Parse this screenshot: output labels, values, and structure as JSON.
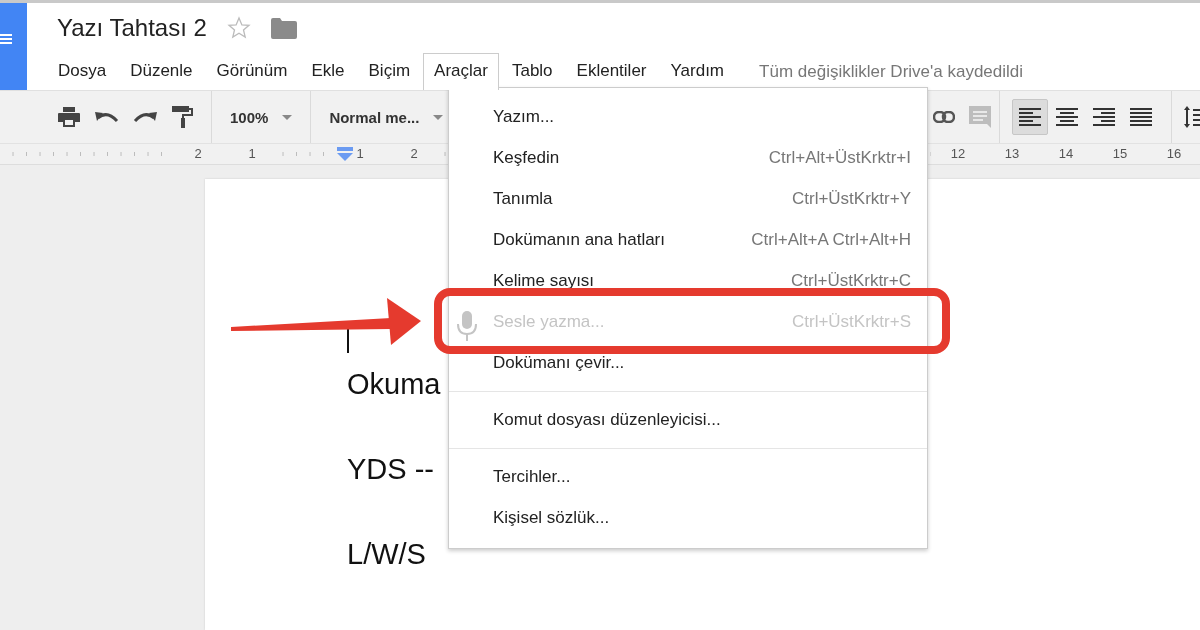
{
  "document": {
    "title": "Yazı Tahtası 2",
    "starred": false
  },
  "menus": [
    {
      "label": "Dosya",
      "selected": false
    },
    {
      "label": "Düzenle",
      "selected": false
    },
    {
      "label": "Görünüm",
      "selected": false
    },
    {
      "label": "Ekle",
      "selected": false
    },
    {
      "label": "Biçim",
      "selected": false
    },
    {
      "label": "Araçlar",
      "selected": true
    },
    {
      "label": "Tablo",
      "selected": false
    },
    {
      "label": "Eklentiler",
      "selected": false
    },
    {
      "label": "Yardım",
      "selected": false
    }
  ],
  "save_status": "Tüm değişiklikler Drive'a kaydedildi",
  "toolbar": {
    "zoom": "100%",
    "style": "Normal me...",
    "alignment": [
      {
        "selected": true
      },
      {
        "selected": false
      },
      {
        "selected": false
      },
      {
        "selected": false
      }
    ]
  },
  "ruler": {
    "left_labels": [
      "2",
      "1"
    ],
    "right_labels": [
      "1",
      "2"
    ],
    "far_labels": [
      "12",
      "13",
      "14",
      "15",
      "16"
    ]
  },
  "body_lines": [
    "Okuma",
    "YDS --",
    "L/W/S"
  ],
  "tools_menu": [
    {
      "kind": "item",
      "label": "Yazım...",
      "disabled": false
    },
    {
      "kind": "item",
      "label": "Keşfedin",
      "shortcut": "Ctrl+Alt+ÜstKrktr+I",
      "disabled": false
    },
    {
      "kind": "item",
      "label": "Tanımla",
      "shortcut": "Ctrl+ÜstKrktr+Y",
      "disabled": false
    },
    {
      "kind": "item",
      "label": "Dokümanın ana hatları",
      "shortcut": "Ctrl+Alt+A Ctrl+Alt+H",
      "disabled": false
    },
    {
      "kind": "item",
      "label": "Kelime sayısı",
      "shortcut": "Ctrl+ÜstKrktr+C",
      "disabled": false
    },
    {
      "kind": "voice",
      "label": "Sesle yazma...",
      "shortcut": "Ctrl+ÜstKrktr+S",
      "disabled": true
    },
    {
      "kind": "item",
      "label": "Dokümanı çevir...",
      "disabled": false
    },
    {
      "kind": "separator"
    },
    {
      "kind": "item",
      "label": "Komut dosyası düzenleyicisi...",
      "disabled": false
    },
    {
      "kind": "separator"
    },
    {
      "kind": "item",
      "label": "Tercihler...",
      "disabled": false
    },
    {
      "kind": "item",
      "label": "Kişisel sözlük...",
      "disabled": false
    }
  ],
  "annotations": [
    {
      "kind": "arrow"
    },
    {
      "kind": "frame"
    }
  ]
}
